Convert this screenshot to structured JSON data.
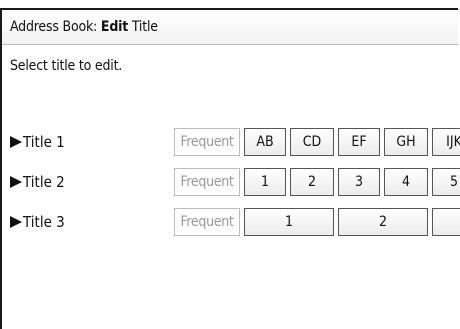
{
  "header": {
    "prefix": "Address Book: ",
    "bold": "Edit",
    "suffix": " Title"
  },
  "instruction": "Select title to edit.",
  "rows": [
    {
      "label": "Title 1",
      "frequent": "Frequent",
      "buttons": [
        "AB",
        "CD",
        "EF",
        "GH",
        "IJK"
      ]
    },
    {
      "label": "Title 2",
      "frequent": "Frequent",
      "buttons": [
        "1",
        "2",
        "3",
        "4",
        "5"
      ]
    },
    {
      "label": "Title 3",
      "frequent": "Frequent",
      "buttons": [
        "1",
        "2",
        ""
      ]
    }
  ],
  "colors": {
    "frequent_text": "#9a9a9a",
    "border": "#555555"
  }
}
